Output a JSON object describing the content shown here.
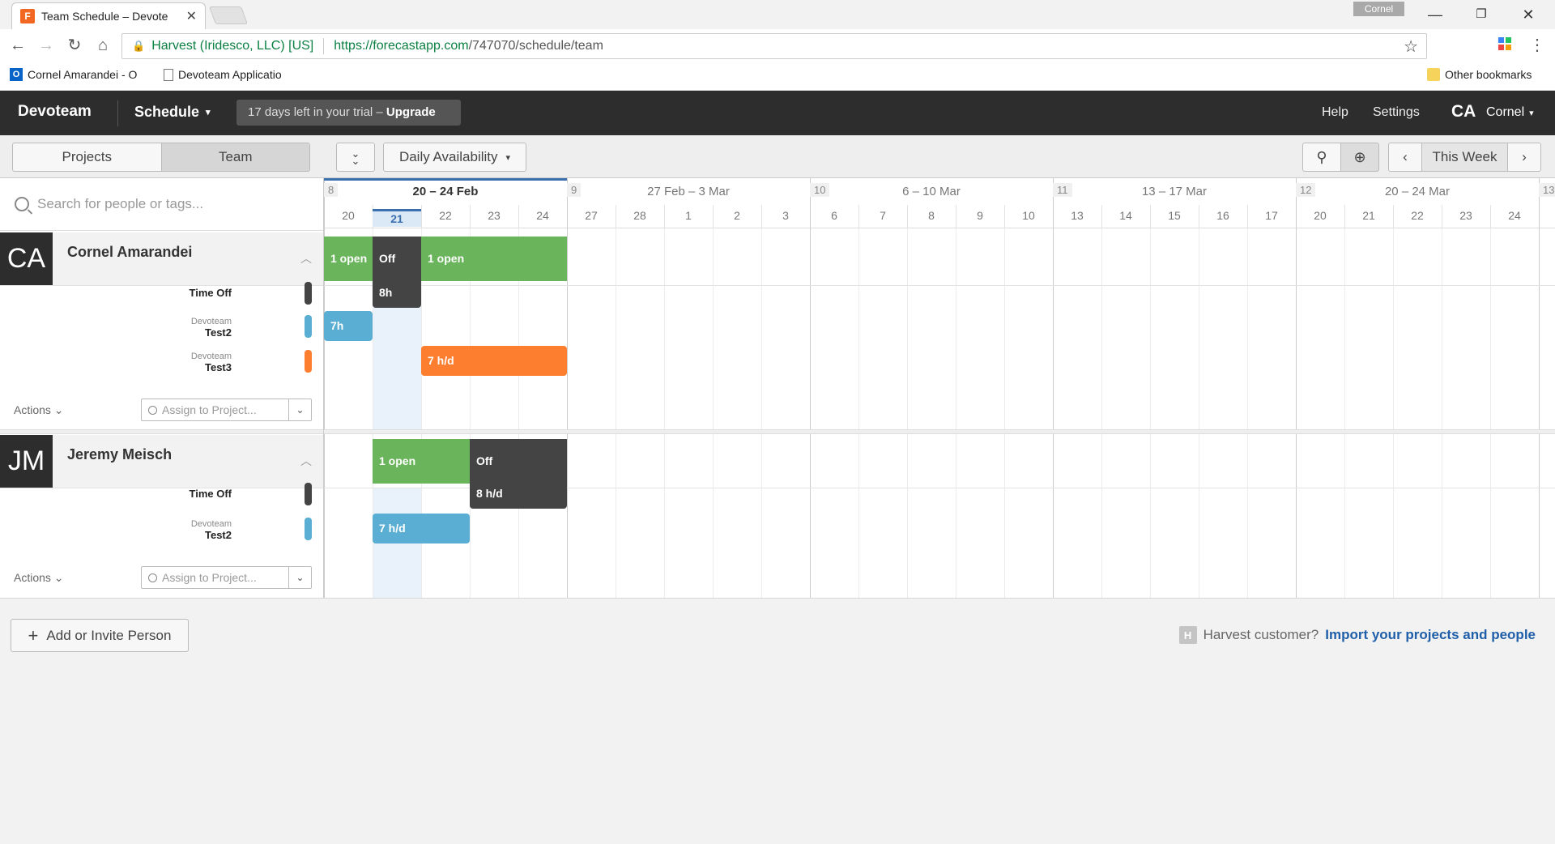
{
  "browser": {
    "tab_title": "Team Schedule – Devote",
    "tab_favicon": "F",
    "profile_chip": "Cornel",
    "site_identity": "Harvest (Iridesco, LLC) [US]",
    "url_domain": "https://forecastapp.com",
    "url_path": "/747070/schedule/team",
    "bookmarks": [
      {
        "label": "Cornel Amarandei - O",
        "icon": "outlook-icon"
      },
      {
        "label": "Devoteam Applicatio",
        "icon": "page-icon"
      }
    ],
    "other_bookmarks": "Other bookmarks"
  },
  "app": {
    "brand": "Devoteam",
    "menu": "Schedule",
    "trial_text": "17 days left in your trial – ",
    "trial_cta": "Upgrade",
    "help": "Help",
    "settings": "Settings",
    "user_initials": "CA",
    "user_name": "Cornel"
  },
  "toolbar": {
    "seg_projects": "Projects",
    "seg_team": "Team",
    "view": "Daily Availability",
    "this_week": "This Week"
  },
  "search": {
    "placeholder": "Search for people or tags..."
  },
  "calendar": {
    "weeks": [
      {
        "num": "8",
        "range": "20 – 24 Feb",
        "days": [
          "20",
          "21",
          "22",
          "23",
          "24"
        ],
        "current": true
      },
      {
        "num": "9",
        "range": "27 Feb – 3 Mar",
        "days": [
          "27",
          "28",
          "1",
          "2",
          "3"
        ]
      },
      {
        "num": "10",
        "range": "6 – 10 Mar",
        "days": [
          "6",
          "7",
          "8",
          "9",
          "10"
        ]
      },
      {
        "num": "11",
        "range": "13 – 17 Mar",
        "days": [
          "13",
          "14",
          "15",
          "16",
          "17"
        ]
      },
      {
        "num": "12",
        "range": "20 – 24 Mar",
        "days": [
          "20",
          "21",
          "22",
          "23",
          "24"
        ]
      },
      {
        "num": "13",
        "range": "",
        "days": []
      }
    ],
    "today": "21"
  },
  "people": [
    {
      "initials": "CA",
      "name": "Cornel Amarandei",
      "summary": [
        {
          "label": "1 open",
          "type": "open"
        },
        {
          "label": "Off",
          "type": "off"
        },
        {
          "label": "1 open",
          "type": "open"
        }
      ],
      "rows": [
        {
          "client": "",
          "project": "Time Off",
          "color": "#444444",
          "bar": "8h"
        },
        {
          "client": "Devoteam",
          "project": "Test2",
          "color": "#5aaed3",
          "bar": "7h"
        },
        {
          "client": "Devoteam",
          "project": "Test3",
          "color": "#fd7e2e",
          "bar": "7 h/d"
        }
      ],
      "actions": "Actions",
      "assign_placeholder": "Assign to Project..."
    },
    {
      "initials": "JM",
      "name": "Jeremy Meisch",
      "summary": [
        {
          "label": "1 open",
          "type": "open"
        },
        {
          "label": "Off",
          "type": "off"
        }
      ],
      "rows": [
        {
          "client": "",
          "project": "Time Off",
          "color": "#444444",
          "bar": "8 h/d"
        },
        {
          "client": "Devoteam",
          "project": "Test2",
          "color": "#5aaed3",
          "bar": "7 h/d"
        }
      ],
      "actions": "Actions",
      "assign_placeholder": "Assign to Project..."
    }
  ],
  "footer": {
    "add_person": "Add or Invite Person",
    "harvest_q": "Harvest customer?",
    "harvest_link": "Import your projects and people"
  },
  "colors": {
    "open": "#6ab55b",
    "off": "#444444",
    "accent": "#3b6fae"
  }
}
